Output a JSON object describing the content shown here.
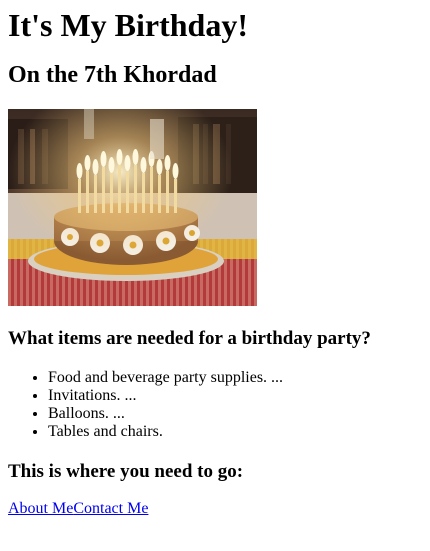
{
  "page": {
    "title": "It's My Birthday!",
    "subtitle": "On the 7th Khordad"
  },
  "photo": {
    "alt": "Birthday cake with lit candles"
  },
  "party": {
    "heading": "What items are needed for a birthday party?",
    "items": [
      "Food and beverage party supplies. ...",
      "Invitations. ...",
      "Balloons. ...",
      "Tables and chairs."
    ]
  },
  "directions": {
    "heading": "This is where you need to go:"
  },
  "links": {
    "about": "About Me",
    "contact": "Contact Me"
  },
  "colors": {
    "link": "#0000ee",
    "text": "#000000",
    "background": "#ffffff"
  }
}
